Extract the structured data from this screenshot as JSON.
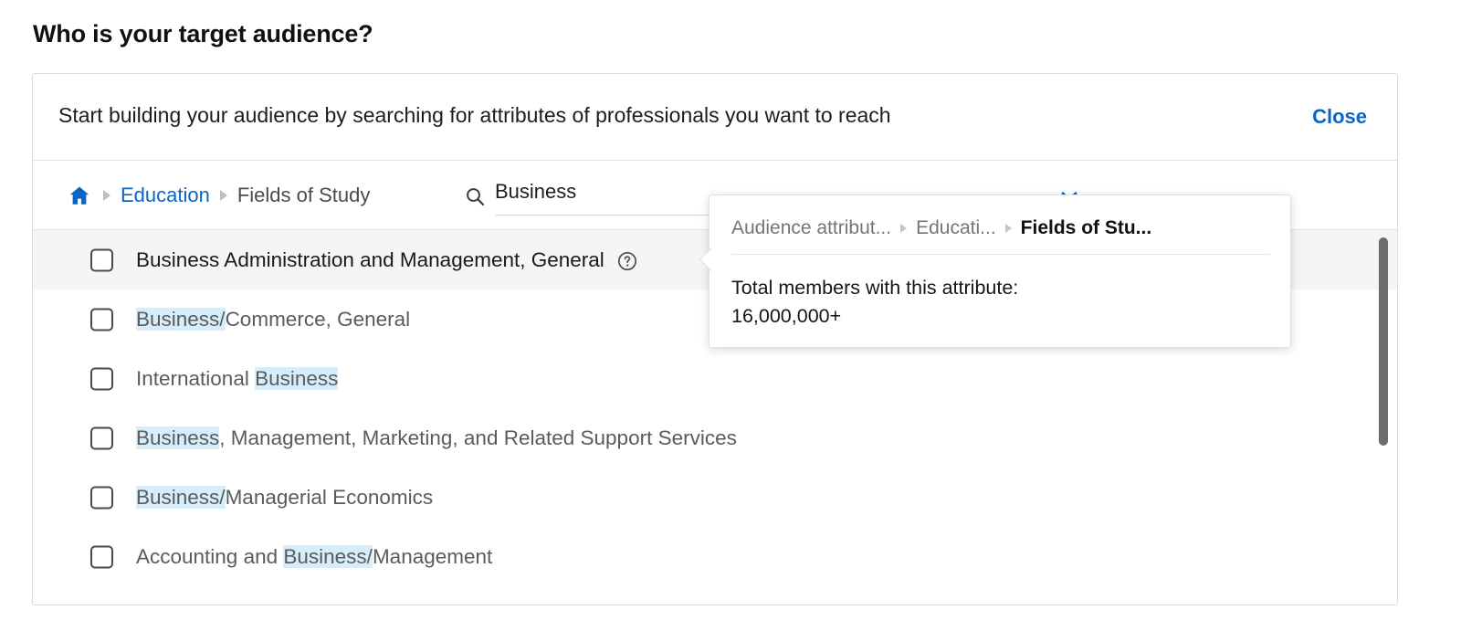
{
  "page_title": "Who is your target audience?",
  "panel": {
    "header_text": "Start building your audience by searching for attributes of professionals you want to reach",
    "close_label": "Close"
  },
  "breadcrumb": {
    "home_icon": "home-icon",
    "items": [
      {
        "label": "Education",
        "active_link": true
      },
      {
        "label": "Fields of Study",
        "active_link": false
      }
    ]
  },
  "search": {
    "icon": "search-icon",
    "value": "Business",
    "placeholder": "Search",
    "dropdown_icon": "chevron-down-icon"
  },
  "results": {
    "rows": [
      {
        "parts": [
          {
            "text": "Business Administration and Management, General",
            "highlight": false
          }
        ],
        "hovered": true,
        "has_help_icon": true,
        "help_icon": "help-circle-icon"
      },
      {
        "parts": [
          {
            "text": "Business/",
            "highlight": true
          },
          {
            "text": "Commerce, General",
            "highlight": false
          }
        ],
        "hovered": false,
        "has_help_icon": false
      },
      {
        "parts": [
          {
            "text": "International ",
            "highlight": false
          },
          {
            "text": "Business",
            "highlight": true
          }
        ],
        "hovered": false,
        "has_help_icon": false
      },
      {
        "parts": [
          {
            "text": "Business",
            "highlight": true
          },
          {
            "text": ", Management, Marketing, and Related Support Services",
            "highlight": false
          }
        ],
        "hovered": false,
        "has_help_icon": false
      },
      {
        "parts": [
          {
            "text": "Business/",
            "highlight": true
          },
          {
            "text": "Managerial Economics",
            "highlight": false
          }
        ],
        "hovered": false,
        "has_help_icon": false
      },
      {
        "parts": [
          {
            "text": "Accounting and ",
            "highlight": false
          },
          {
            "text": "Business/",
            "highlight": true
          },
          {
            "text": "Management",
            "highlight": false
          }
        ],
        "hovered": false,
        "has_help_icon": false
      }
    ],
    "scrollbar": {
      "visible": true
    }
  },
  "tooltip": {
    "breadcrumb": [
      {
        "label": "Audience attribut...",
        "bold": false
      },
      {
        "label": "Educati...",
        "bold": false
      },
      {
        "label": "Fields of Stu...",
        "bold": true
      }
    ],
    "body_line1": "Total members with this attribute:",
    "body_line2": "16,000,000+"
  },
  "colors": {
    "accent_blue": "#0a66c2",
    "highlight_blue": "#d6edfb",
    "hover_gray": "#f4f5f6",
    "border_gray": "#dcdcdc",
    "text_primary": "#1a1a1a",
    "text_secondary": "#5b5b5b"
  }
}
